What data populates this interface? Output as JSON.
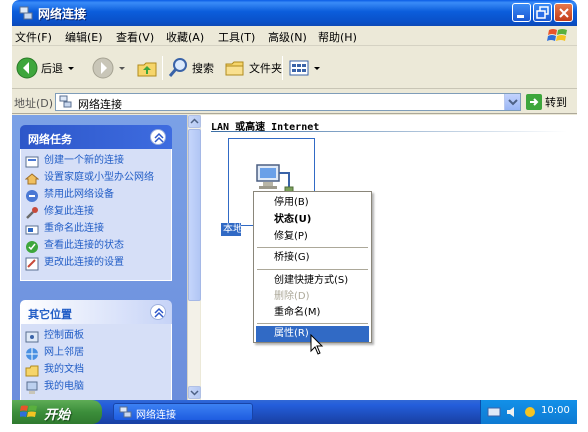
{
  "window": {
    "title": "网络连接"
  },
  "menubar": {
    "items": [
      "文件(F)",
      "编辑(E)",
      "查看(V)",
      "收藏(A)",
      "工具(T)",
      "高级(N)",
      "帮助(H)"
    ]
  },
  "toolbar": {
    "back_label": "后退",
    "search_label": "搜索",
    "folders_label": "文件夹"
  },
  "address": {
    "label": "地址(D)",
    "value": "网络连接",
    "go_label": "转到"
  },
  "taskpane": {
    "network_tasks": {
      "title": "网络任务",
      "items": [
        "创建一个新的连接",
        "设置家庭或小型办公网络",
        "禁用此网络设备",
        "修复此连接",
        "重命名此连接",
        "查看此连接的状态",
        "更改此连接的设置"
      ]
    },
    "other_places": {
      "title": "其它位置",
      "items": [
        "控制面板",
        "网上邻居",
        "我的文档",
        "我的电脑"
      ]
    }
  },
  "content": {
    "group_title": "LAN 或高速 Internet",
    "connection_label": "本地"
  },
  "context_menu": {
    "items": [
      "停用(B)",
      "状态(U)",
      "修复(P)",
      "桥接(G)",
      "创建快捷方式(S)",
      "删除(D)",
      "重命名(M)",
      "属性(R)"
    ]
  },
  "taskbar": {
    "start_label": "开始",
    "window_button": "网络连接",
    "clock": "10:00"
  },
  "colors": {
    "title_blue": "#0b5ddb",
    "selection": "#316ac5",
    "task_link": "#215dc6",
    "start_green": "#3c8e3b"
  }
}
